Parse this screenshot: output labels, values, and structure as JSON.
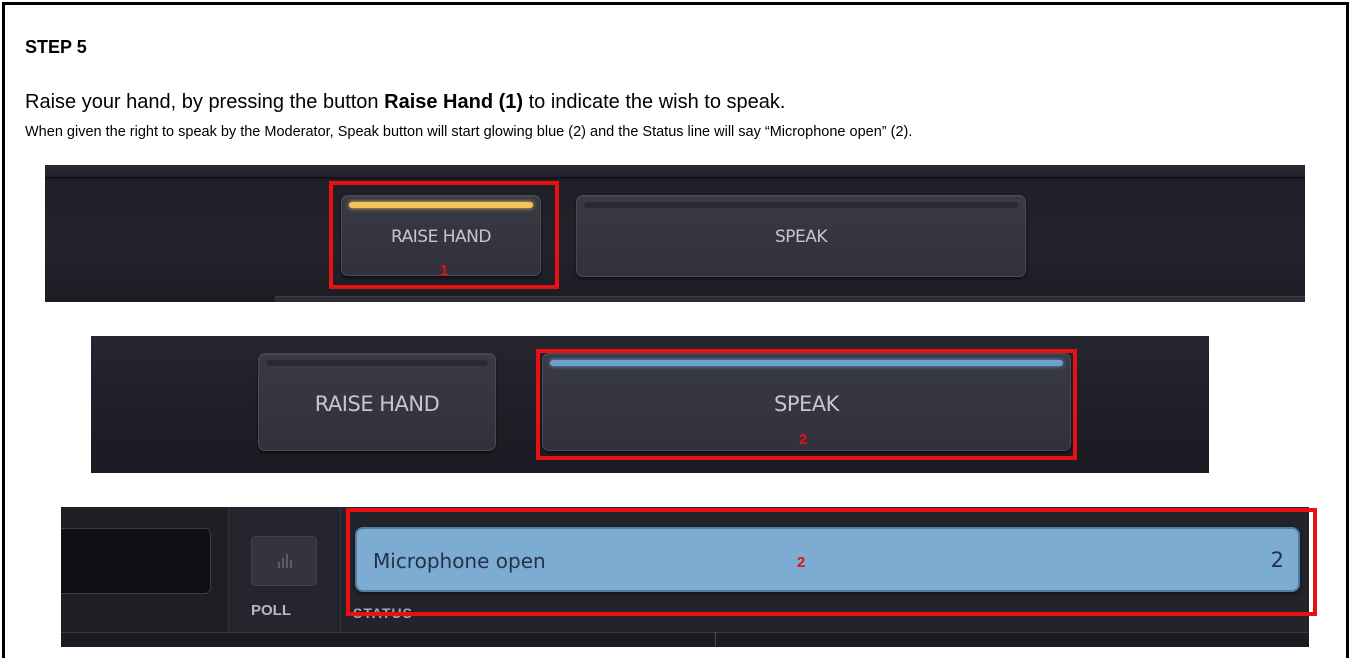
{
  "step_title": "STEP 5",
  "instruction_line1": {
    "before": "Raise your hand, by pressing the button ",
    "bold": "Raise Hand (1)",
    "after": " to indicate the wish to speak."
  },
  "instruction_line2": "When given the right to speak by the Moderator, Speak button will start glowing blue (2) and the Status line will say “Microphone open” (2).",
  "panel1": {
    "raise_hand_label": "RAISE HAND",
    "speak_label": "SPEAK",
    "callout_number": "1",
    "raise_hand_indicator_color": "#f5c358"
  },
  "panel2": {
    "raise_hand_label": "RAISE HAND",
    "speak_label": "SPEAK",
    "callout_number": "2",
    "speak_indicator_color": "#6f9fd1"
  },
  "panel3": {
    "poll_label": "POLL",
    "status_label": "STATUS",
    "status_text": "Microphone open",
    "status_count": "2",
    "callout_number": "2",
    "status_color": "#7dacd3"
  },
  "colors": {
    "callout_red": "#e81010",
    "panel_bg": "#1f1f27"
  }
}
